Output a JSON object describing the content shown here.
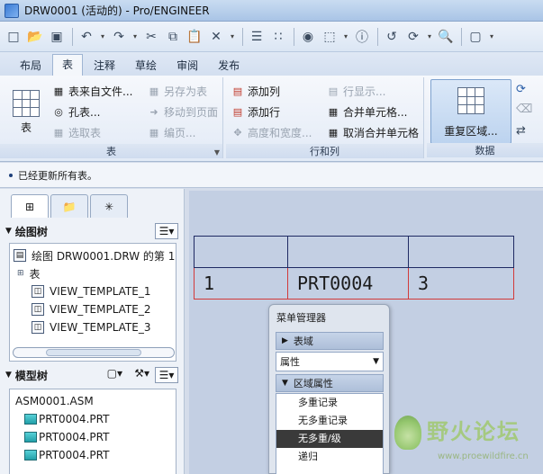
{
  "window": {
    "title": "DRW0001 (活动的) - Pro/ENGINEER"
  },
  "tabs": [
    {
      "label": "布局"
    },
    {
      "label": "表",
      "active": true
    },
    {
      "label": "注释"
    },
    {
      "label": "草绘"
    },
    {
      "label": "审阅"
    },
    {
      "label": "发布"
    }
  ],
  "ribbon": {
    "table_group": {
      "label": "表",
      "big_button": "表",
      "from_file": "表来自文件...",
      "save_as_table": "另存为表",
      "hole_table": "孔表...",
      "move_to_page": "移动到页面",
      "select_table": "选取表",
      "edit_page": "编页..."
    },
    "rows_cols_group": {
      "label": "行和列",
      "add_col": "添加列",
      "add_row": "添加行",
      "height_width": "高度和宽度...",
      "row_display": "行显示...",
      "merge_cells": "合并单元格...",
      "unmerge_cells": "取消合并单元格"
    },
    "data_group": {
      "label": "数据",
      "repeat_region": "重复区域..."
    }
  },
  "status": {
    "message": "已经更新所有表。"
  },
  "left_panel": {
    "drawing_tree": {
      "title": "绘图树",
      "items": [
        {
          "label": "绘图 DRW0001.DRW 的第 1"
        },
        {
          "label": "表"
        },
        {
          "label": "VIEW_TEMPLATE_1"
        },
        {
          "label": "VIEW_TEMPLATE_2"
        },
        {
          "label": "VIEW_TEMPLATE_3"
        }
      ]
    },
    "model_tree": {
      "title": "模型树",
      "root": "ASM0001.ASM",
      "items": [
        {
          "label": "PRT0004.PRT"
        },
        {
          "label": "PRT0004.PRT"
        },
        {
          "label": "PRT0004.PRT"
        }
      ]
    }
  },
  "drawing_table": {
    "rows": [
      [
        "",
        "",
        ""
      ],
      [
        "1",
        "PRT0004",
        "3"
      ]
    ]
  },
  "menu_manager": {
    "title": "菜单管理器",
    "section_region": "表域",
    "attribute_select": "属性",
    "section_region_attr": "区域属性",
    "items": [
      {
        "label": "多重记录",
        "selected": false
      },
      {
        "label": "无多重记录",
        "selected": false
      },
      {
        "label": "无多重/级",
        "selected": true
      },
      {
        "label": "递归",
        "selected": false
      }
    ]
  },
  "watermark": {
    "title": "野火论坛",
    "url": "www.proewildfire.cn"
  }
}
